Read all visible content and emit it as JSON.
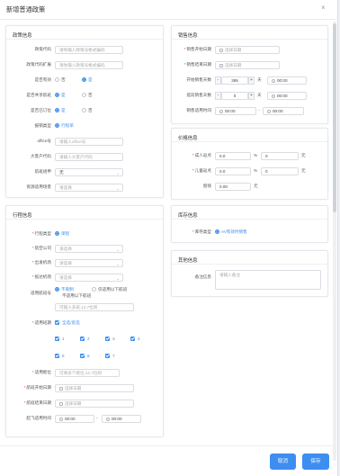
{
  "dialog": {
    "title": "新增普通政策",
    "close_glyph": "×"
  },
  "policy": {
    "title": "政策信息",
    "code_label": "政策代码",
    "code_placeholder": "请你输入政策号格式编码",
    "code_ext_label": "政策代码扩展",
    "code_ext_placeholder": "请你输入政策号格式编码",
    "active_label": "是否有效",
    "shared_label": "是否共享航班",
    "seat_label": "是否已订位",
    "yes": "是",
    "no": "否",
    "report_label": "报销类型",
    "report_value": "行程单",
    "office_label": "office号",
    "office_placeholder": "请输入office号",
    "bigcust_label": "大客户代码",
    "bigcust_placeholder": "请输入大客户代码",
    "airline_sel_label": "航班组申",
    "airline_sel_value": "无",
    "resource_label": "资源适用场景",
    "resource_placeholder": "请选择"
  },
  "sales": {
    "title": "销售信息",
    "start_label": "销售开始日期",
    "start_placeholder": "选择日期",
    "end_label": "销售结束日期",
    "end_placeholder": "选择日期",
    "open_days_label": "开始销售天数",
    "open_days_value": "365",
    "day_unit": "天",
    "open_time": "00:00",
    "ahead_label": "提前销售天数",
    "ahead_value": "0",
    "ahead_time": "00:00",
    "time_range_label": "销售适用时间",
    "time_from": "00:00",
    "time_to": "00:00",
    "dash": "-"
  },
  "price": {
    "title": "价格信息",
    "adult_label": "成人返点",
    "adult_value": "0.0",
    "child_label": "儿童返点",
    "child_value": "0.0",
    "stay_label": "留钱",
    "stay_value": "0.00",
    "pct": "%",
    "yuan": "元"
  },
  "stock": {
    "title": "库存信息",
    "type_label": "库存类型",
    "type_value": "AV有效时销售"
  },
  "other": {
    "title": "其他信息",
    "remark_label": "备注信息",
    "remark_placeholder": "请输入备注"
  },
  "trip": {
    "title": "行程信息",
    "type_label": "行程类型",
    "type_value": "单程",
    "airline_label": "航空公司",
    "airline_placeholder": "请选择",
    "dep_label": "出发机场",
    "dep_placeholder": "请选择",
    "arr_label": "抵达机场",
    "arr_placeholder": "请选择",
    "flight_label": "适用航班号",
    "unlimited": "不限制",
    "only_below": "仅适用以下航班",
    "not_below": "不适用以下航班",
    "flight_placeholder": "可输入多班,12,7位则",
    "period_label": "适用班期",
    "all_check": "全选/反选",
    "days": [
      "1",
      "2",
      "3",
      "4",
      "5",
      "6",
      "7"
    ],
    "cabin_label": "适用舱位",
    "cabin_placeholder": "可填多个舱位,12,7位则",
    "fly_start_label": "航班开始日期",
    "fly_start_placeholder": "选择日期",
    "fly_end_label": "航班结束日期",
    "fly_end_placeholder": "选择日期",
    "fly_time_label": "起飞适用时间",
    "fly_time_from": "00:00",
    "fly_time_to": "00:00"
  },
  "footer": {
    "cancel": "取消",
    "save": "保存"
  },
  "colors": {
    "accent": "#3d8ef0",
    "required": "#e53935"
  }
}
